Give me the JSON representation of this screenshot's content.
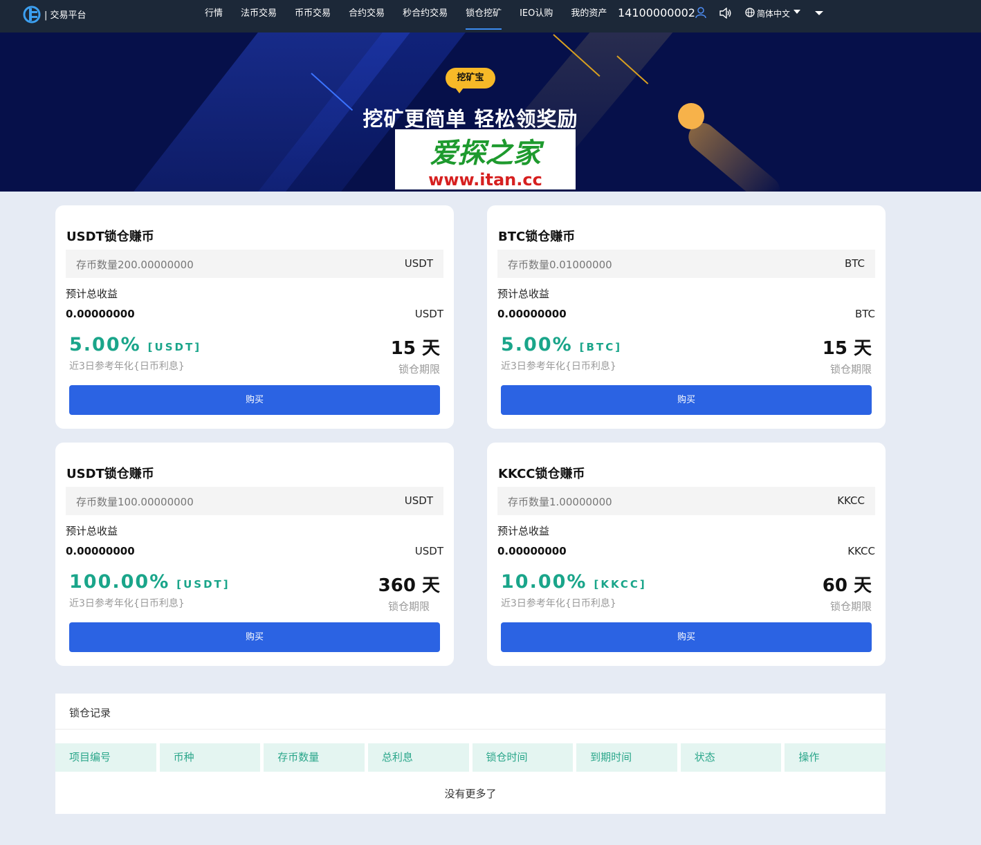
{
  "nav": {
    "brand": "| 交易平台",
    "links": [
      "行情",
      "法币交易",
      "币币交易",
      "合约交易",
      "秒合约交易",
      "锁仓挖矿",
      "IEO认购",
      "我的资产"
    ],
    "active_index": 5,
    "account": "14100000002",
    "language": "简体中文"
  },
  "banner": {
    "badge": "挖矿宝",
    "headline": "挖矿更简单 轻松领奖励",
    "watermark_text": "爱探之家",
    "watermark_url": "www.itan.cc"
  },
  "cards": [
    {
      "title": "USDT锁仓赚币",
      "amount_placeholder": "存币数量200.00000000",
      "currency": "USDT",
      "estimate_label": "预计总收益",
      "estimate_value": "0.00000000",
      "rate": "5.00%",
      "rate_tag": "[USDT]",
      "rate_sub": "近3日参考年化{日币利息}",
      "days": "15 天",
      "days_sub": "锁仓期限",
      "buy_label": "购买"
    },
    {
      "title": "BTC锁仓赚币",
      "amount_placeholder": "存币数量0.01000000",
      "currency": "BTC",
      "estimate_label": "预计总收益",
      "estimate_value": "0.00000000",
      "rate": "5.00%",
      "rate_tag": "[BTC]",
      "rate_sub": "近3日参考年化{日币利息}",
      "days": "15 天",
      "days_sub": "锁仓期限",
      "buy_label": "购买"
    },
    {
      "title": "USDT锁仓赚币",
      "amount_placeholder": "存币数量100.00000000",
      "currency": "USDT",
      "estimate_label": "预计总收益",
      "estimate_value": "0.00000000",
      "rate": "100.00%",
      "rate_tag": "[USDT]",
      "rate_sub": "近3日参考年化{日币利息}",
      "days": "360 天",
      "days_sub": "锁仓期限",
      "buy_label": "购买"
    },
    {
      "title": "KKCC锁仓赚币",
      "amount_placeholder": "存币数量1.00000000",
      "currency": "KKCC",
      "estimate_label": "预计总收益",
      "estimate_value": "0.00000000",
      "rate": "10.00%",
      "rate_tag": "[KKCC]",
      "rate_sub": "近3日参考年化{日币利息}",
      "days": "60 天",
      "days_sub": "锁仓期限",
      "buy_label": "购买"
    }
  ],
  "records": {
    "title": "锁仓记录",
    "columns": [
      "项目编号",
      "币种",
      "存币数量",
      "总利息",
      "锁仓时间",
      "到期时间",
      "状态",
      "操作"
    ],
    "empty_text": "没有更多了"
  },
  "colors": {
    "nav_bg": "#1c2838",
    "banner_bg": "#06104a",
    "accent_blue": "#2b63e3",
    "rate_green": "#1aa58a",
    "badge_yellow": "#f7b928",
    "page_bg": "#e6ebf4"
  }
}
